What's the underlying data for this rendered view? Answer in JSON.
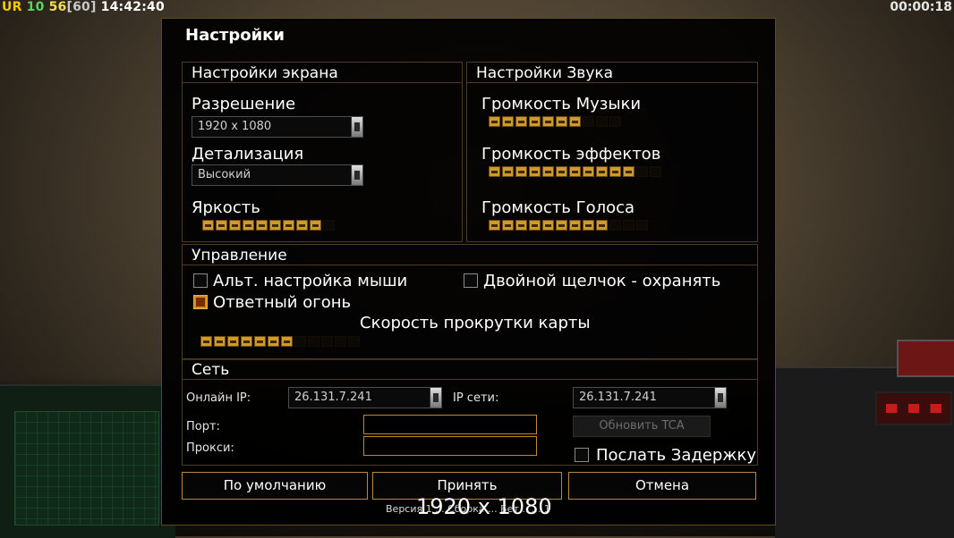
{
  "hud": {
    "ur_label": "UR",
    "val1": "10",
    "val2": "56",
    "val3": "[60]",
    "time": "14:42:40",
    "timer": "00:00:18"
  },
  "settings": {
    "title": "Настройки",
    "screen": {
      "title": "Настройки экрана",
      "resolution_label": "Разрешение",
      "resolution_value": "1920 x 1080",
      "detail_label": "Детализация",
      "detail_value": "Высокий",
      "brightness_label": "Яркость",
      "brightness_level": 0.9
    },
    "sound": {
      "title": "Настройки Звука",
      "music_label": "Громкость Музыки",
      "music_level": 0.65,
      "effects_label": "Громкость эффектов",
      "effects_level": 0.82,
      "voice_label": "Громкость Голоса",
      "voice_level": 0.72
    },
    "controls": {
      "title": "Управление",
      "alt_mouse_label": "Альт. настройка мыши",
      "alt_mouse_checked": false,
      "double_click_label": "Двойной щелчок - охранять",
      "double_click_checked": false,
      "return_fire_label": "Ответный огонь",
      "return_fire_checked": true,
      "scroll_speed_label": "Скорость прокрутки карты",
      "scroll_speed_level": 0.55
    },
    "network": {
      "title": "Сеть",
      "online_ip_label": "Онлайн IP:",
      "online_ip_value": "26.131.7.241",
      "net_ip_label": "IP сети:",
      "net_ip_value": "26.131.7.241",
      "port_label": "Порт:",
      "proxy_label": "Прокси:",
      "update_tca_label": "Обновить TCA",
      "send_delay_label": "Послать Задержку",
      "send_delay_checked": false
    },
    "buttons": {
      "default": "По умолчанию",
      "accept": "Принять",
      "cancel": "Отмена"
    },
    "version_text": "Версия 1 ... Сборка ... Бет... ... 1",
    "resolution_overlay": "1920 x 1080"
  },
  "colors": {
    "ur": "#f6c900",
    "hud_10": "#5fd35f",
    "hud_56": "#f4e14a",
    "hud_60": "#c8c8c8"
  }
}
